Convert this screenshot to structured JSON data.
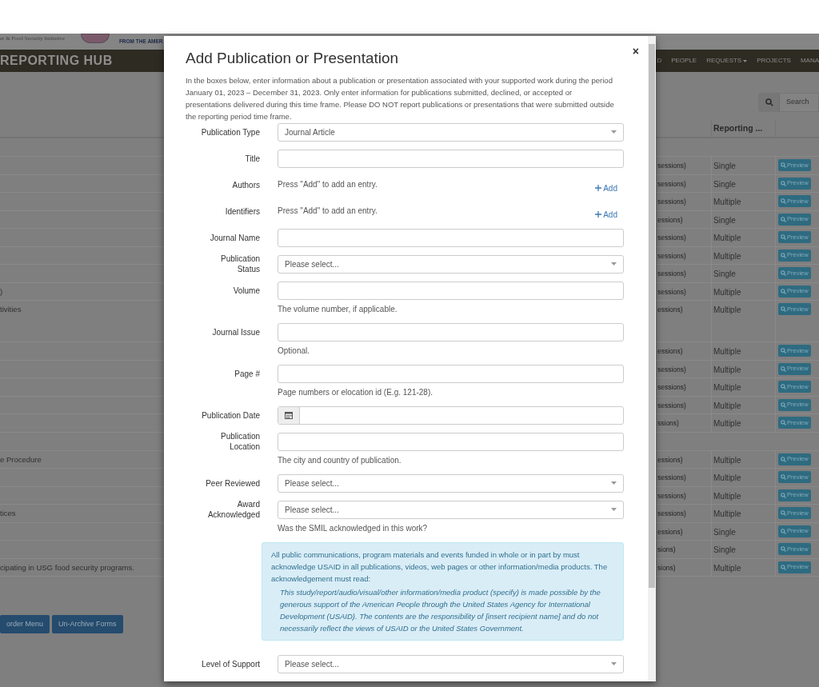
{
  "header": {
    "tagline": "er & Food Security Initiative",
    "agency": "FROM THE AMER"
  },
  "navbar": {
    "brand": "REPORTING HUB",
    "items": [
      {
        "label": "D",
        "dropdown": false
      },
      {
        "label": "PEOPLE",
        "dropdown": false
      },
      {
        "label": "REQUESTS",
        "dropdown": true
      },
      {
        "label": "PROJECTS",
        "dropdown": false
      },
      {
        "label": "MANA",
        "dropdown": false
      }
    ]
  },
  "search": {
    "placeholder": "Search"
  },
  "table": {
    "columns": [
      "Reporting ..."
    ],
    "rows": [
      {
        "kind": "group"
      },
      {
        "kind": "form",
        "sessions": "sessions)",
        "reporting": "Single",
        "action": "Preview"
      },
      {
        "kind": "form",
        "sessions": "sessions)",
        "reporting": "Single",
        "action": "Preview"
      },
      {
        "kind": "form",
        "sessions": "sessions)",
        "reporting": "Multiple",
        "action": "Preview"
      },
      {
        "kind": "form",
        "sessions": "essions)",
        "reporting": "Single",
        "action": "Preview"
      },
      {
        "kind": "form",
        "sessions": "sessions)",
        "reporting": "Multiple",
        "action": "Preview"
      },
      {
        "kind": "form",
        "sessions": "sessions)",
        "reporting": "Multiple",
        "action": "Preview"
      },
      {
        "kind": "form",
        "sessions": "sessions)",
        "reporting": "Single",
        "action": "Preview"
      },
      {
        "kind": "form",
        "name": ")",
        "sessions": "sessions)",
        "reporting": "Multiple",
        "action": "Preview"
      },
      {
        "kind": "form",
        "name": "tivities",
        "sessions": "essions)",
        "reporting": "Multiple",
        "action": "Preview",
        "tall": true
      },
      {
        "kind": "form",
        "sessions": "essions)",
        "reporting": "Multiple",
        "action": "Preview"
      },
      {
        "kind": "form",
        "sessions": "sessions)",
        "reporting": "Multiple",
        "action": "Preview"
      },
      {
        "kind": "form",
        "sessions": "sessions)",
        "reporting": "Multiple",
        "action": "Preview"
      },
      {
        "kind": "form",
        "sessions": "sessions)",
        "reporting": "Multiple",
        "action": "Preview"
      },
      {
        "kind": "form",
        "sessions": "ssions)",
        "reporting": "Multiple",
        "action": "Preview"
      },
      {
        "kind": "group"
      },
      {
        "kind": "form",
        "name": "e Procedure",
        "sessions": "essions)",
        "reporting": "Multiple",
        "action": "Preview"
      },
      {
        "kind": "form",
        "sessions": "sessions)",
        "reporting": "Multiple",
        "action": "Preview"
      },
      {
        "kind": "form",
        "sessions": "sessions)",
        "reporting": "Multiple",
        "action": "Preview"
      },
      {
        "kind": "form",
        "name": "tices",
        "sessions": "sessions)",
        "reporting": "Multiple",
        "action": "Preview"
      },
      {
        "kind": "form",
        "sessions": "essions)",
        "reporting": "Single",
        "action": "Preview"
      },
      {
        "kind": "form",
        "sessions": "sions)",
        "reporting": "Single",
        "action": "Preview"
      },
      {
        "kind": "form",
        "name": "cipating in USG food security programs.",
        "sessions": "sions)",
        "reporting": "Multiple",
        "action": "Preview"
      }
    ]
  },
  "buttons": [
    "order Menu",
    "Un-Archive Forms"
  ],
  "modal": {
    "title": "Add Publication or Presentation",
    "close": "×",
    "intro": "In the boxes below, enter information about a publication or presentation associated with your supported work during the period January 01, 2023 – December 31, 2023. Only enter information for publications submitted, declined, or accepted or presentations delivered during this time frame. Please DO NOT report publications or presentations that were submitted outside the reporting period time frame.",
    "fields": [
      {
        "kind": "select",
        "label": "Publication Type",
        "value": "Journal Article"
      },
      {
        "kind": "text",
        "label": "Title"
      },
      {
        "kind": "list",
        "label": "Authors",
        "empty": "Press \"Add\" to add an entry.",
        "add": "Add"
      },
      {
        "kind": "list",
        "label": "Identifiers",
        "empty": "Press \"Add\" to add an entry.",
        "add": "Add"
      },
      {
        "kind": "text",
        "label": "Journal Name"
      },
      {
        "kind": "select",
        "label": "Publication Status",
        "value": "Please select..."
      },
      {
        "kind": "text",
        "label": "Volume",
        "help": "The volume number, if applicable."
      },
      {
        "kind": "text",
        "label": "Journal Issue",
        "help": "Optional."
      },
      {
        "kind": "text",
        "label": "Page #",
        "help": "Page numbers or elocation id (E.g. 121-28)."
      },
      {
        "kind": "date",
        "label": "Publication Date"
      },
      {
        "kind": "text",
        "label": "Publication Location",
        "help": "The city and country of publication."
      },
      {
        "kind": "select",
        "label": "Peer Reviewed",
        "value": "Please select..."
      },
      {
        "kind": "select",
        "label": "Award Acknowledged",
        "value": "Please select...",
        "help": "Was the SMIL acknowledged in this work?"
      },
      {
        "kind": "notice",
        "text": "All public communications, program materials and events funded in whole or in part by must acknowledge USAID in all publications, videos, web pages or other information/media products. The acknowledgement must read:",
        "quote": "This study/report/audio/visual/other information/media product (specify) is made possible by the generous support of the American People through the United States Agency for International Development (USAID). The contents are the responsibility of [insert recipient name] and do not necessarily reflect the views of USAID or the United States Government."
      },
      {
        "kind": "select",
        "label": "Level of Support",
        "value": "Please select..."
      }
    ]
  }
}
